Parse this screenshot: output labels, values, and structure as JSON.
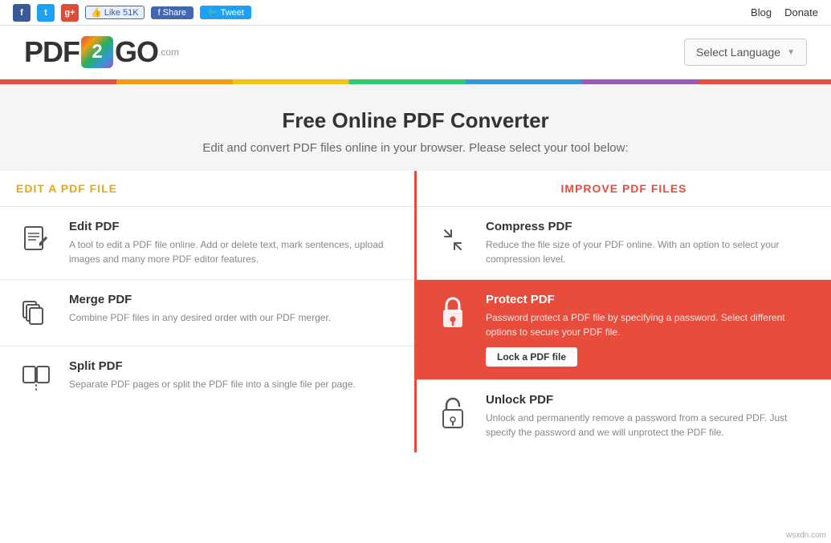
{
  "topbar": {
    "social": {
      "facebook_icon": "f",
      "twitter_icon": "t",
      "gplus_icon": "g+",
      "like_label": "👍 Like 51K",
      "share_label": "f Share",
      "tweet_label": "🐦 Tweet"
    },
    "blog_label": "Blog",
    "donate_label": "Donate"
  },
  "header": {
    "logo_pdf": "PDF",
    "logo_num": "2",
    "logo_go": "GO",
    "logo_com": ".com",
    "select_language_label": "Select Language"
  },
  "hero": {
    "title": "Free Online PDF Converter",
    "subtitle": "Edit and convert PDF files online in your browser. Please select your tool below:"
  },
  "col_left": {
    "header": "EDIT A PDF FILE",
    "tools": [
      {
        "name": "Edit PDF",
        "description": "A tool to edit a PDF file online. Add or delete text, mark sentences, upload images and many more PDF editor features.",
        "icon": "✏️"
      },
      {
        "name": "Merge PDF",
        "description": "Combine PDF files in any desired order with our PDF merger.",
        "icon": "📋"
      },
      {
        "name": "Split PDF",
        "description": "Separate PDF pages or split the PDF file into a single file per page.",
        "icon": "📄"
      }
    ]
  },
  "col_right": {
    "header": "IMPROVE PDF FILES",
    "tools": [
      {
        "name": "Compress PDF",
        "description": "Reduce the file size of your PDF online. With an option to select your compression level.",
        "icon": "compress",
        "highlighted": false
      },
      {
        "name": "Protect PDF",
        "description": "Password protect a PDF file by specifying a password. Select different options to secure your PDF file.",
        "icon": "lock",
        "highlighted": true,
        "cta_label": "Lock a PDF file"
      },
      {
        "name": "Unlock PDF",
        "description": "Unlock and permanently remove a password from a secured PDF. Just specify the password and we will unprotect the PDF file.",
        "icon": "unlock",
        "highlighted": false
      }
    ]
  },
  "watermark": "wsxdn.com"
}
